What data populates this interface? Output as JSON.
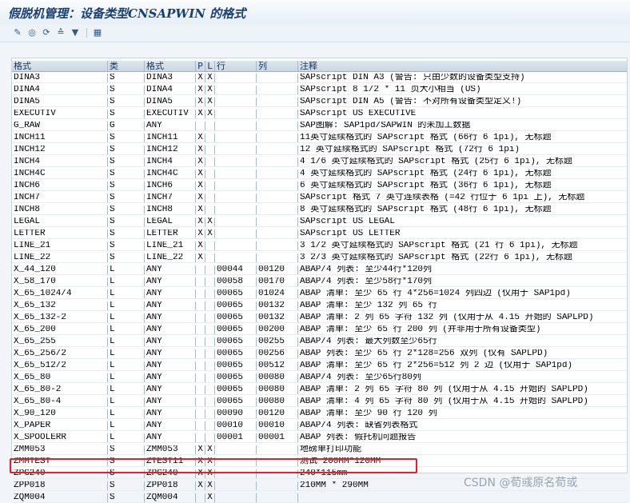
{
  "window": {
    "title": "假脱机管理：设备类型CNSAPWIN 的格式"
  },
  "toolbar": {
    "icons": [
      "pencil-icon",
      "display-icon",
      "refresh-icon",
      "sort-icon",
      "filter-icon",
      "export-icon"
    ]
  },
  "columns": [
    "格式",
    "类",
    "格式",
    "P",
    "L",
    "行",
    "列",
    "注释"
  ],
  "rows": [
    [
      "DINA3",
      "S",
      "DINA3",
      "X",
      "X",
      "",
      "",
      "SAPscript DIN A3 (警告: 只由少数的设备类型支持)"
    ],
    [
      "DINA4",
      "S",
      "DINA4",
      "X",
      "X",
      "",
      "",
      "SAPscript 8 1/2 * 11 页大小相当 (US)"
    ],
    [
      "DINA5",
      "S",
      "DINA5",
      "X",
      "X",
      "",
      "",
      "SAPscript DIN A5 (警告: 不对所有设备类型定义!)"
    ],
    [
      "EXECUTIV",
      "S",
      "EXECUTIV",
      "X",
      "X",
      "",
      "",
      "SAPscript US EXECUTIVE"
    ],
    [
      "G_RAW",
      "G",
      "ANY",
      "",
      "",
      "",
      "",
      "SAP图解: SAP1pd/SAPWIN 的未加工数据"
    ],
    [
      "INCH11",
      "S",
      "INCH11",
      "X",
      "",
      "",
      "",
      "11英寸延续格式的 SAPscript 格式 (66行 6 1pi), 无标题"
    ],
    [
      "INCH12",
      "S",
      "INCH12",
      "X",
      "",
      "",
      "",
      "12 英寸延续格式的 SAPscript 格式 (72行 6 1pi)"
    ],
    [
      "INCH4",
      "S",
      "INCH4",
      "X",
      "",
      "",
      "",
      "4 1/6 英寸延续格式的 SAPscript 格式 (25行 6 1pi), 无标题"
    ],
    [
      "INCH4C",
      "S",
      "INCH4C",
      "X",
      "",
      "",
      "",
      "4 英寸延续格式的 SAPscript 格式 (24行 6 1pi), 无标题"
    ],
    [
      "INCH6",
      "S",
      "INCH6",
      "X",
      "",
      "",
      "",
      "6 英寸延续格式的 SAPscript 格式 (36行 6 1pi), 无标题"
    ],
    [
      "INCH7",
      "S",
      "INCH7",
      "X",
      "",
      "",
      "",
      "SAPscript 格式 7 英寸连续表格 (=42 行位于 6 1pi 上), 无标题"
    ],
    [
      "INCH8",
      "S",
      "INCH8",
      "X",
      "",
      "",
      "",
      "8 英寸延续格式的 SAPscript 格式 (48行 6 1pi), 无标题"
    ],
    [
      "LEGAL",
      "S",
      "LEGAL",
      "X",
      "X",
      "",
      "",
      "SAPscript US LEGAL"
    ],
    [
      "LETTER",
      "S",
      "LETTER",
      "X",
      "X",
      "",
      "",
      "SAPscript US LETTER"
    ],
    [
      "LINE_21",
      "S",
      "LINE_21",
      "X",
      "",
      "",
      "",
      "3 1/2 英寸延续格式的 SAPscript 格式 (21 行 6 1pi), 无标题"
    ],
    [
      "LINE_22",
      "S",
      "LINE_22",
      "X",
      "",
      "",
      "",
      "3 2/3 英寸延续格式的 SAPscript 格式 (22行 6 1pi), 无标题"
    ],
    [
      "X_44_120",
      "L",
      "ANY",
      "",
      "",
      "00044",
      "00120",
      "ABAP/4 列表: 至少44行*120列"
    ],
    [
      "X_58_170",
      "L",
      "ANY",
      "",
      "",
      "00058",
      "00170",
      "ABAP/4 列表: 至少58行*170列"
    ],
    [
      "X_65_1024/4",
      "L",
      "ANY",
      "",
      "",
      "00065",
      "01024",
      "ABAP 清单: 至少 65 行 4*256=1024 列四边 (仅用于 SAP1pd)"
    ],
    [
      "X_65_132",
      "L",
      "ANY",
      "",
      "",
      "00065",
      "00132",
      "ABAP 清单: 至少 132 列 65 行"
    ],
    [
      "X_65_132-2",
      "L",
      "ANY",
      "",
      "",
      "00065",
      "00132",
      "ABAP 清单: 2 列 65 字符 132 列 (仅用于从 4.15 开始的 SAPLPD)"
    ],
    [
      "X_65_200",
      "L",
      "ANY",
      "",
      "",
      "00065",
      "00200",
      "ABAP 清单: 至少 65 行 200 列 (并非用于所有设备类型)"
    ],
    [
      "X_65_255",
      "L",
      "ANY",
      "",
      "",
      "00065",
      "00255",
      "ABAP/4 列表: 最大列数至少65行"
    ],
    [
      "X_65_256/2",
      "L",
      "ANY",
      "",
      "",
      "00065",
      "00256",
      "ABAP 列表: 至少 65 行 2*128=256 双列 (仅有 SAPLPD)"
    ],
    [
      "X_65_512/2",
      "L",
      "ANY",
      "",
      "",
      "00065",
      "00512",
      "ABAP 清单: 至少 65 行 2*256=512 列 2 边 (仅用于 SAP1pd)"
    ],
    [
      "X_65_80",
      "L",
      "ANY",
      "",
      "",
      "00065",
      "00080",
      "ABAP/4 列表: 至少65行80列"
    ],
    [
      "X_65_80-2",
      "L",
      "ANY",
      "",
      "",
      "00065",
      "00080",
      "ABAP 清单: 2 列 65 字符 80 列 (仅用于从 4.15 开始的 SAPLPD)"
    ],
    [
      "X_65_80-4",
      "L",
      "ANY",
      "",
      "",
      "00065",
      "00080",
      "ABAP 清单: 4 列 65 字符 80 列 (仅用于从 4.15 开始的 SAPLPD)"
    ],
    [
      "X_90_120",
      "L",
      "ANY",
      "",
      "",
      "00090",
      "00120",
      "ABAP 清单: 至少 90 行 120 列"
    ],
    [
      "X_PAPER",
      "L",
      "ANY",
      "",
      "",
      "00010",
      "00010",
      "ABAP/4 列表: 缺省列表格式"
    ],
    [
      "X_SPOOLERR",
      "L",
      "ANY",
      "",
      "",
      "00001",
      "00001",
      "ABAP 列表: 假托机问题报告"
    ],
    [
      "ZMM053",
      "S",
      "ZMM053",
      "X",
      "X",
      "",
      "",
      "地磅单打印功能"
    ],
    [
      "ZMMTEST",
      "S",
      "ZTEST11",
      "X",
      "X",
      "",
      "",
      "测试 200MM*120MM"
    ],
    [
      "ZPG240",
      "S",
      "ZPG240",
      "X",
      "X",
      "",
      "",
      "240*115mm"
    ],
    [
      "ZPP018",
      "S",
      "ZPP018",
      "X",
      "X",
      "",
      "",
      "210MM * 290MM"
    ],
    [
      "ZQM004",
      "S",
      "ZQM004",
      "",
      "X",
      "",
      "",
      ""
    ]
  ],
  "watermark": "CSDN @荀彧原名荀或"
}
